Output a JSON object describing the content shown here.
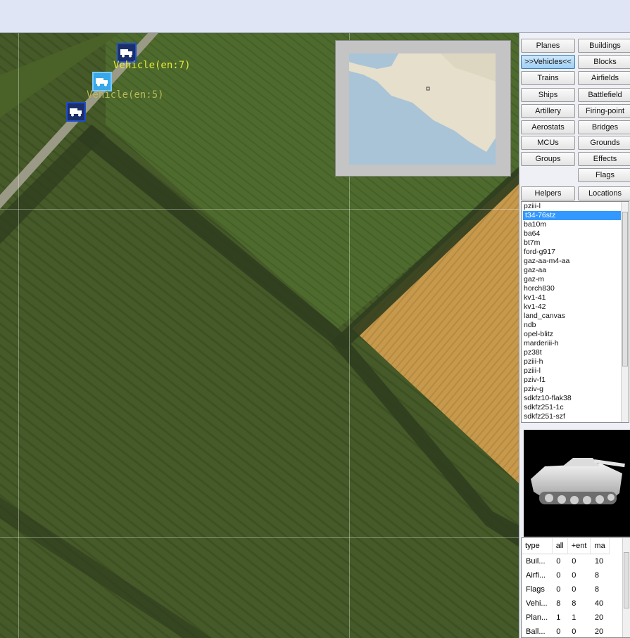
{
  "map": {
    "vehicles": [
      {
        "name": "vehicle-marker-1",
        "label": "Vehicle(en:7)",
        "selected": false
      },
      {
        "name": "vehicle-marker-2",
        "label": "Vehicle(en:5)",
        "selected": true
      },
      {
        "name": "vehicle-marker-3",
        "label": "",
        "selected": false
      }
    ]
  },
  "panel": {
    "buttons": [
      {
        "label": "Planes",
        "active": false
      },
      {
        "label": "Buildings",
        "active": false
      },
      {
        "label": ">>Vehicles<<",
        "active": true
      },
      {
        "label": "Blocks",
        "active": false
      },
      {
        "label": "Trains",
        "active": false
      },
      {
        "label": "Airfields",
        "active": false
      },
      {
        "label": "Ships",
        "active": false
      },
      {
        "label": "Battlefield",
        "active": false
      },
      {
        "label": "Artillery",
        "active": false
      },
      {
        "label": "Firing-point",
        "active": false
      },
      {
        "label": "Aerostats",
        "active": false
      },
      {
        "label": "Bridges",
        "active": false
      },
      {
        "label": "MCUs",
        "active": false
      },
      {
        "label": "Grounds",
        "active": false
      },
      {
        "label": "Groups",
        "active": false
      },
      {
        "label": "Effects",
        "active": false
      },
      {
        "label": "Flags",
        "active": false
      },
      {
        "label": "Helpers",
        "active": false
      },
      {
        "label": "Locations",
        "active": false
      }
    ],
    "object_list": {
      "items": [
        "pziii-l",
        "t34-76stz",
        "ba10m",
        "ba64",
        "bt7m",
        "ford-g917",
        "gaz-aa-m4-aa",
        "gaz-aa",
        "gaz-m",
        "horch830",
        "kv1-41",
        "kv1-42",
        "land_canvas",
        "ndb",
        "opel-blitz",
        "marderiii-h",
        "pz38t",
        "pziii-h",
        "pziii-l",
        "pziv-f1",
        "pziv-g",
        "sdkfz10-flak38",
        "sdkfz251-1c",
        "sdkfz251-szf"
      ],
      "selected": "t34-76stz"
    },
    "stats": {
      "columns": [
        "type",
        "all",
        "+ent",
        "ma"
      ],
      "rows": [
        [
          "Buil...",
          "0",
          "0",
          "10"
        ],
        [
          "Airfi...",
          "0",
          "0",
          "8"
        ],
        [
          "Flags",
          "0",
          "0",
          "8"
        ],
        [
          "Vehi...",
          "8",
          "8",
          "40"
        ],
        [
          "Plan...",
          "1",
          "1",
          "20"
        ],
        [
          "Ball...",
          "0",
          "0",
          "20"
        ]
      ]
    }
  },
  "colors": {
    "selection": "#3399ff",
    "marker_border": "#1f4fc8",
    "label_yellow": "#e8e83a"
  }
}
